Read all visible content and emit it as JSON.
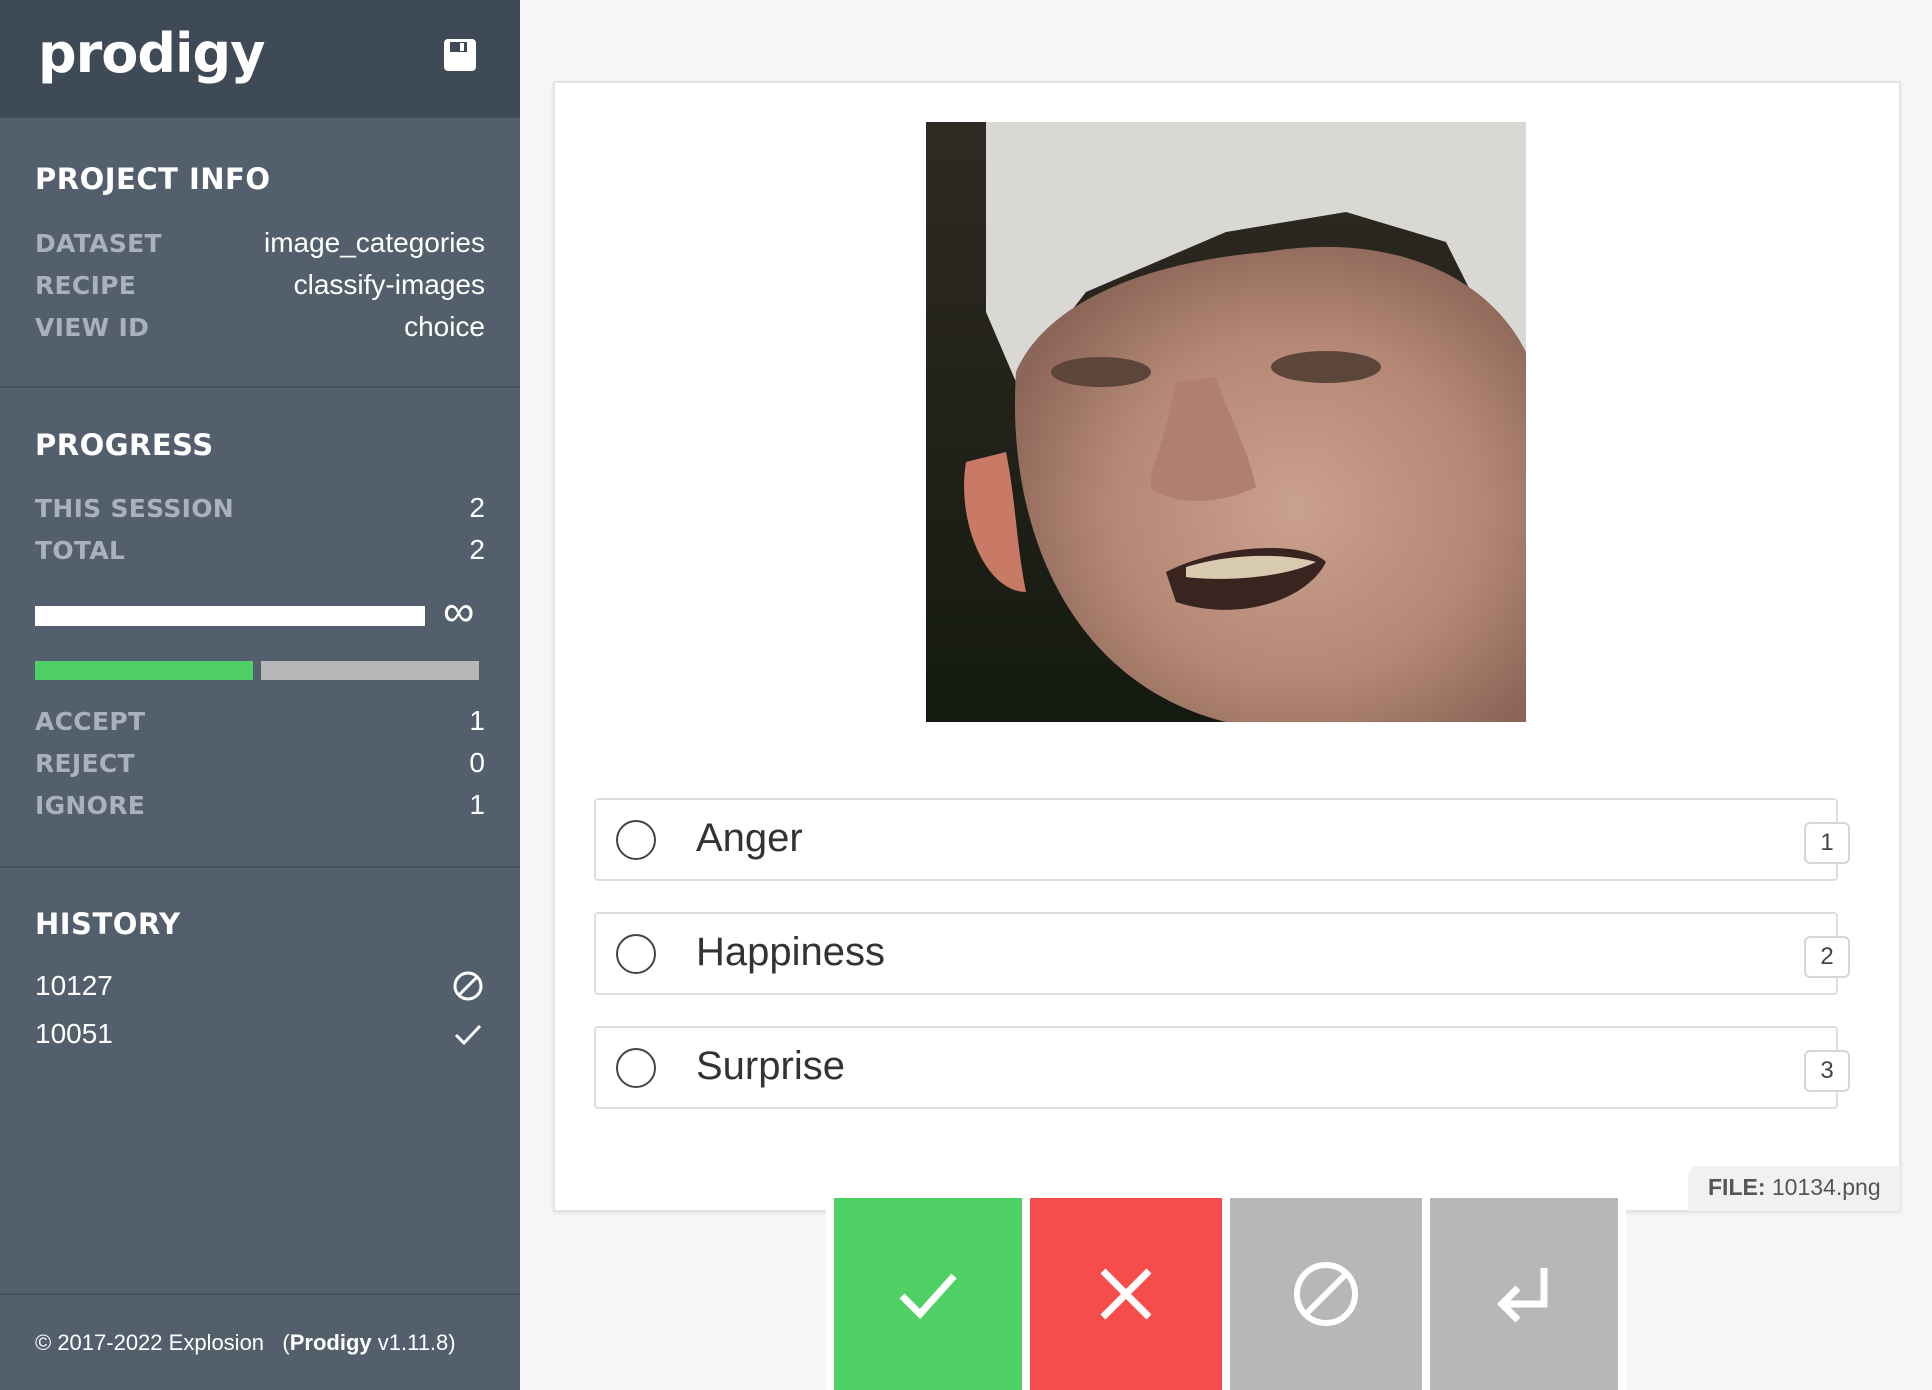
{
  "app": {
    "logo": "prodigy"
  },
  "icons": {
    "save": "save-icon",
    "infinity": "infinity-icon",
    "ignore": "ignore-icon",
    "accept": "check-icon",
    "reject": "cross-icon",
    "undo": "undo-icon"
  },
  "project_info": {
    "title": "PROJECT INFO",
    "rows": [
      {
        "key": "DATASET",
        "value": "image_categories"
      },
      {
        "key": "RECIPE",
        "value": "classify-images"
      },
      {
        "key": "VIEW ID",
        "value": "choice"
      }
    ]
  },
  "progress": {
    "title": "PROGRESS",
    "rows": [
      {
        "key": "THIS SESSION",
        "value": "2"
      },
      {
        "key": "TOTAL",
        "value": "2"
      }
    ],
    "infinity": "∞",
    "counts": [
      {
        "key": "ACCEPT",
        "value": "1"
      },
      {
        "key": "REJECT",
        "value": "0"
      },
      {
        "key": "IGNORE",
        "value": "1"
      }
    ],
    "colors": {
      "accept": "#4fd065",
      "remaining": "#b7b7b7"
    }
  },
  "history": {
    "title": "HISTORY",
    "items": [
      {
        "id": "10127",
        "status": "ignore-icon"
      },
      {
        "id": "10051",
        "status": "check-icon"
      }
    ]
  },
  "footer": {
    "copyright": "© 2017-2022 Explosion",
    "product": "Prodigy",
    "version": "v1.11.8"
  },
  "task": {
    "options": [
      {
        "label": "Anger",
        "key": "1"
      },
      {
        "label": "Happiness",
        "key": "2"
      },
      {
        "label": "Surprise",
        "key": "3"
      }
    ],
    "file_label": "FILE:",
    "file_name": "10134.png"
  },
  "colors": {
    "sidebar": "#535f6c",
    "header": "#3e4a56",
    "accept": "#4fd065",
    "reject": "#f74c4c",
    "neutral": "#b7b7b7"
  }
}
